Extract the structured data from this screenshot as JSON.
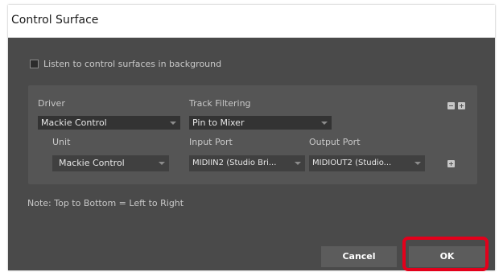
{
  "dialog": {
    "title": "Control Surface"
  },
  "background_option": {
    "label": "Listen to control surfaces in background",
    "checked": false
  },
  "driver": {
    "label": "Driver",
    "value": "Mackie Control"
  },
  "track_filtering": {
    "label": "Track Filtering",
    "value": "Pin to Mixer"
  },
  "unit": {
    "label": "Unit",
    "value": "Mackie Control"
  },
  "input_port": {
    "label": "Input Port",
    "value": "MIDIIN2 (Studio Bri..."
  },
  "output_port": {
    "label": "Output Port",
    "value": "MIDIOUT2 (Studio..."
  },
  "note": "Note: Top to Bottom = Left to Right",
  "buttons": {
    "cancel": "Cancel",
    "ok": "OK"
  },
  "colors": {
    "dialog_bg": "#4a4a4a",
    "panel_bg": "#555555",
    "highlight": "#e3001b"
  },
  "icons": {
    "remove": "minus-icon",
    "add": "plus-icon",
    "dropdown": "chevron-down-icon"
  }
}
